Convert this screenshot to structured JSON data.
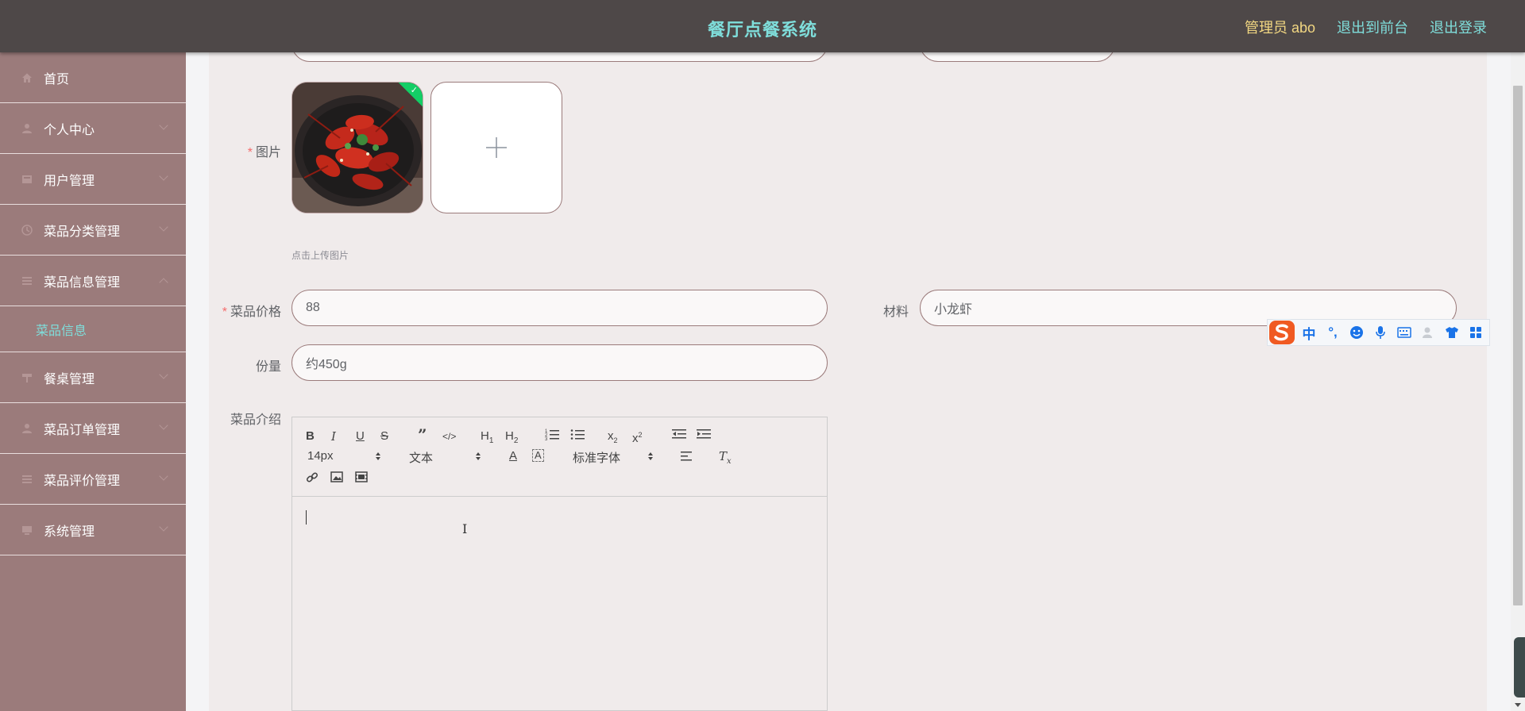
{
  "header": {
    "title": "餐厅点餐系统",
    "admin_label": "管理员 abo",
    "exit_front_label": "退出到前台",
    "logout_label": "退出登录"
  },
  "sidebar": {
    "items": [
      {
        "label": "首页",
        "icon": "home-icon",
        "has_arrow": false
      },
      {
        "label": "个人中心",
        "icon": "user-icon",
        "has_arrow": true
      },
      {
        "label": "用户管理",
        "icon": "folder-icon",
        "has_arrow": true
      },
      {
        "label": "菜品分类管理",
        "icon": "category-icon",
        "has_arrow": true
      },
      {
        "label": "菜品信息管理",
        "icon": "list-icon",
        "has_arrow": true,
        "expanded": true
      },
      {
        "label": "餐桌管理",
        "icon": "table-icon",
        "has_arrow": true
      },
      {
        "label": "菜品订单管理",
        "icon": "user-icon",
        "has_arrow": true
      },
      {
        "label": "菜品评价管理",
        "icon": "list-icon",
        "has_arrow": true
      },
      {
        "label": "系统管理",
        "icon": "monitor-icon",
        "has_arrow": true
      }
    ],
    "sub_item_label": "菜品信息"
  },
  "form": {
    "image_label": "图片",
    "upload_tip": "点击上传图片",
    "price_label": "菜品价格",
    "price_value": "88",
    "material_label": "材料",
    "material_value": "小龙虾",
    "portion_label": "份量",
    "portion_value": "约450g",
    "intro_label": "菜品介绍"
  },
  "editor": {
    "font_size": "14px",
    "header_style": "文本",
    "font_family": "标准字体"
  },
  "ime": {
    "mode_label": "中",
    "punct_label": "°,"
  },
  "colors": {
    "topbar_bg": "#4e4848",
    "accent": "#7fdedb",
    "admin_gold": "#f2d782",
    "sidebar_bg": "#9b7b7b",
    "main_bg": "#f0ebeb",
    "required": "#f56c6c"
  }
}
